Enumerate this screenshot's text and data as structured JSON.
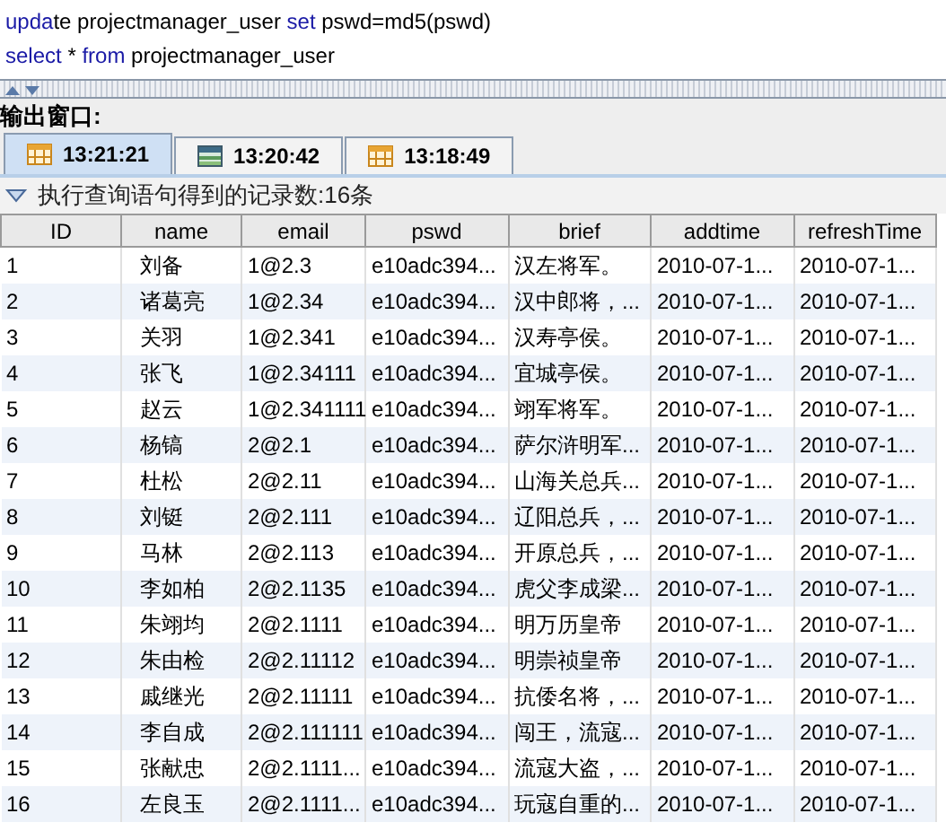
{
  "editor": {
    "lines": [
      [
        {
          "text": "upda",
          "kind": "keyword"
        },
        {
          "text": "te projectmanager_user ",
          "kind": "plain"
        },
        {
          "text": "set",
          "kind": "keyword"
        },
        {
          "text": " pswd=md5(pswd)",
          "kind": "plain"
        }
      ],
      [
        {
          "text": "select",
          "kind": "keyword"
        },
        {
          "text": " * ",
          "kind": "plain"
        },
        {
          "text": "from",
          "kind": "keyword"
        },
        {
          "text": " projectmanager_user",
          "kind": "plain"
        }
      ]
    ]
  },
  "output": {
    "title": "输出窗口:",
    "tabs": [
      {
        "label": "13:21:21",
        "kind": "grid",
        "selected": true
      },
      {
        "label": "13:20:42",
        "kind": "sheet",
        "selected": false
      },
      {
        "label": "13:18:49",
        "kind": "grid",
        "selected": false
      }
    ],
    "summary": {
      "text": "执行查询语句得到的记录数:16条",
      "expanded": true
    },
    "table": {
      "columns": [
        "ID",
        "name",
        "email",
        "pswd",
        "brief",
        "addtime",
        "refreshTime"
      ],
      "rows": [
        [
          "1",
          "刘备",
          "1@2.3",
          "e10adc394...",
          "汉左将军。",
          "2010-07-1...",
          "2010-07-1..."
        ],
        [
          "2",
          "诸葛亮",
          "1@2.34",
          "e10adc394...",
          "汉中郎将，...",
          "2010-07-1...",
          "2010-07-1..."
        ],
        [
          "3",
          "关羽",
          "1@2.341",
          "e10adc394...",
          "汉寿亭侯。",
          "2010-07-1...",
          "2010-07-1..."
        ],
        [
          "4",
          "张飞",
          "1@2.34111",
          "e10adc394...",
          "宜城亭侯。",
          "2010-07-1...",
          "2010-07-1..."
        ],
        [
          "5",
          "赵云",
          "1@2.341111",
          "e10adc394...",
          "翊军将军。",
          "2010-07-1...",
          "2010-07-1..."
        ],
        [
          "6",
          "杨镐",
          "2@2.1",
          "e10adc394...",
          "萨尔浒明军...",
          "2010-07-1...",
          "2010-07-1..."
        ],
        [
          "7",
          "杜松",
          "2@2.11",
          "e10adc394...",
          "山海关总兵...",
          "2010-07-1...",
          "2010-07-1..."
        ],
        [
          "8",
          "刘铤",
          "2@2.111",
          "e10adc394...",
          "辽阳总兵，...",
          "2010-07-1...",
          "2010-07-1..."
        ],
        [
          "9",
          "马林",
          "2@2.113",
          "e10adc394...",
          "开原总兵，...",
          "2010-07-1...",
          "2010-07-1..."
        ],
        [
          "10",
          "李如柏",
          "2@2.1135",
          "e10adc394...",
          "虎父李成梁...",
          "2010-07-1...",
          "2010-07-1..."
        ],
        [
          "11",
          "朱翊均",
          "2@2.1111",
          "e10adc394...",
          "明万历皇帝",
          "2010-07-1...",
          "2010-07-1..."
        ],
        [
          "12",
          "朱由检",
          "2@2.11112",
          "e10adc394...",
          "明崇祯皇帝",
          "2010-07-1...",
          "2010-07-1..."
        ],
        [
          "13",
          "戚继光",
          "2@2.11111",
          "e10adc394...",
          "抗倭名将，...",
          "2010-07-1...",
          "2010-07-1..."
        ],
        [
          "14",
          "李自成",
          "2@2.111111",
          "e10adc394...",
          "闯王，流寇...",
          "2010-07-1...",
          "2010-07-1..."
        ],
        [
          "15",
          "张献忠",
          "2@2.1111...",
          "e10adc394...",
          "流寇大盗，...",
          "2010-07-1...",
          "2010-07-1..."
        ],
        [
          "16",
          "左良玉",
          "2@2.1111...",
          "e10adc394...",
          "玩寇自重的...",
          "2010-07-1...",
          "2010-07-1..."
        ]
      ]
    }
  }
}
